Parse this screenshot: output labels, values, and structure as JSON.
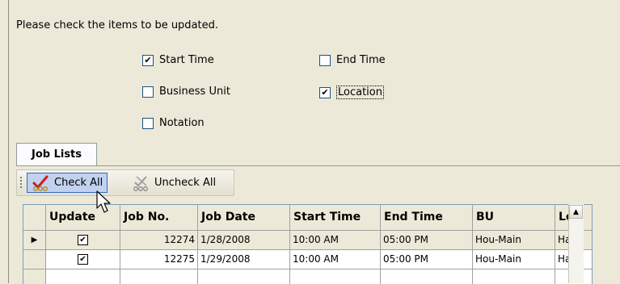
{
  "prompt": "Please check the items to be updated.",
  "options": {
    "start_time": {
      "label": "Start Time",
      "checked": true
    },
    "end_time": {
      "label": "End Time",
      "checked": false
    },
    "business_unit": {
      "label": "Business Unit",
      "checked": false
    },
    "location": {
      "label": "Location",
      "checked": true
    },
    "notation": {
      "label": "Notation",
      "checked": false
    }
  },
  "tabs": {
    "job_lists": "Job Lists"
  },
  "toolbar": {
    "check_all": "Check All",
    "uncheck_all": "Uncheck All",
    "check_icon": "check-all-icon",
    "uncheck_icon": "uncheck-all-icon"
  },
  "grid": {
    "columns": [
      "Update",
      "Job No.",
      "Job Date",
      "Start Time",
      "End Time",
      "BU",
      "Loc"
    ],
    "rows": [
      {
        "update": "✔",
        "job_no": "12274",
        "job_date": "1/28/2008",
        "start_time": "10:00 AM",
        "end_time": "05:00 PM",
        "bu": "Hou-Main",
        "loc": "Harr",
        "current": true
      },
      {
        "update": "✔",
        "job_no": "12275",
        "job_date": "1/29/2008",
        "start_time": "10:00 AM",
        "end_time": "05:00 PM",
        "bu": "Hou-Main",
        "loc": "Harr",
        "current": false
      }
    ],
    "current_row_marker": "▶",
    "scroll_up_glyph": "▲"
  },
  "glyphs": {
    "check": "✔"
  },
  "colors": {
    "background": "#ece9d8",
    "hover_fill": "#c1d2ee",
    "hover_border": "#316ac5"
  }
}
